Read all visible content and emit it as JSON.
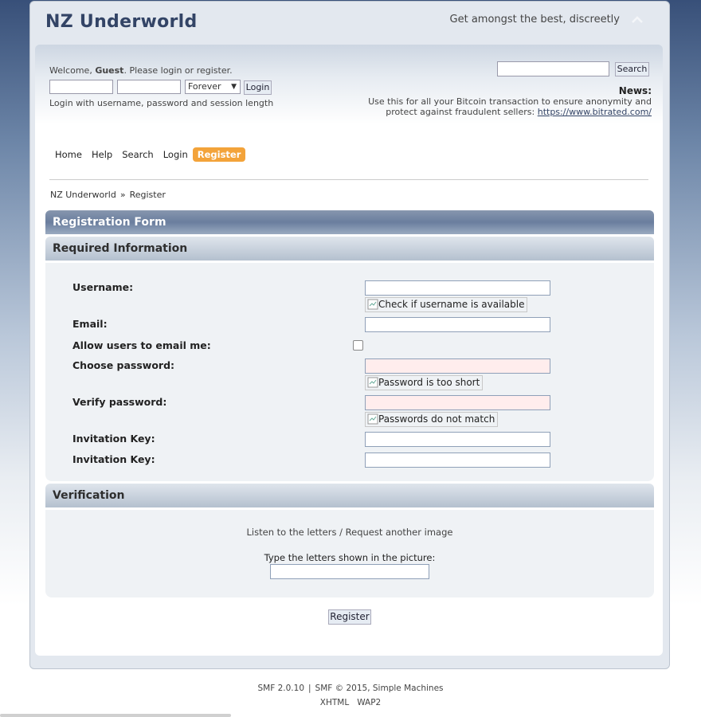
{
  "header": {
    "forum_title": "NZ Underworld",
    "slogan": "Get amongst the best, discreetly",
    "collapse_icon": "chevron-up-icon"
  },
  "user_area": {
    "welcome_prefix": "Welcome, ",
    "welcome_guest": "Guest",
    "welcome_suffix": ". Please ",
    "login_link": "login",
    "or_text": " or ",
    "register_link": "register",
    "period": ".",
    "username_value": "",
    "password_value": "",
    "session_length": "Forever",
    "login_button": "Login",
    "hint": "Login with username, password and session length"
  },
  "search": {
    "value": "",
    "button": "Search"
  },
  "news": {
    "label": "News:",
    "text": "Use this for all your Bitcoin transaction to ensure anonymity and protect against fraudulent sellers:",
    "link": "https://www.bitrated.com/"
  },
  "menu": {
    "items": [
      {
        "label": "Home"
      },
      {
        "label": "Help"
      },
      {
        "label": "Search"
      },
      {
        "label": "Login"
      },
      {
        "label": "Register"
      }
    ]
  },
  "breadcrumb": {
    "home": "NZ Underworld",
    "separator": "»",
    "current": "Register"
  },
  "registration": {
    "title": "Registration Form",
    "required_title": "Required Information",
    "fields": {
      "username": "Username:",
      "username_check": "Check if username is available",
      "email": "Email:",
      "allow_email": "Allow users to email me:",
      "choose_password": "Choose password:",
      "password_error": "Password is too short",
      "verify_password": "Verify password:",
      "verify_error": "Passwords do not match",
      "invitation_key_1": "Invitation Key:",
      "invitation_key_2": "Invitation Key:"
    },
    "allow_email_checked": false
  },
  "verification": {
    "title": "Verification",
    "listen_link": "Listen to the letters",
    "link_separator": " / ",
    "request_link": "Request another image",
    "prompt": "Type the letters shown in the picture:"
  },
  "register_button": "Register",
  "footer": {
    "smf_version": "SMF 2.0.10",
    "separator": "|",
    "copyright": "SMF © 2015, Simple Machines",
    "xhtml": "XHTML",
    "wap2": "WAP2"
  },
  "colors": {
    "accent": "#f3a33a",
    "title": "#334466",
    "error_field": "#ffeded"
  }
}
